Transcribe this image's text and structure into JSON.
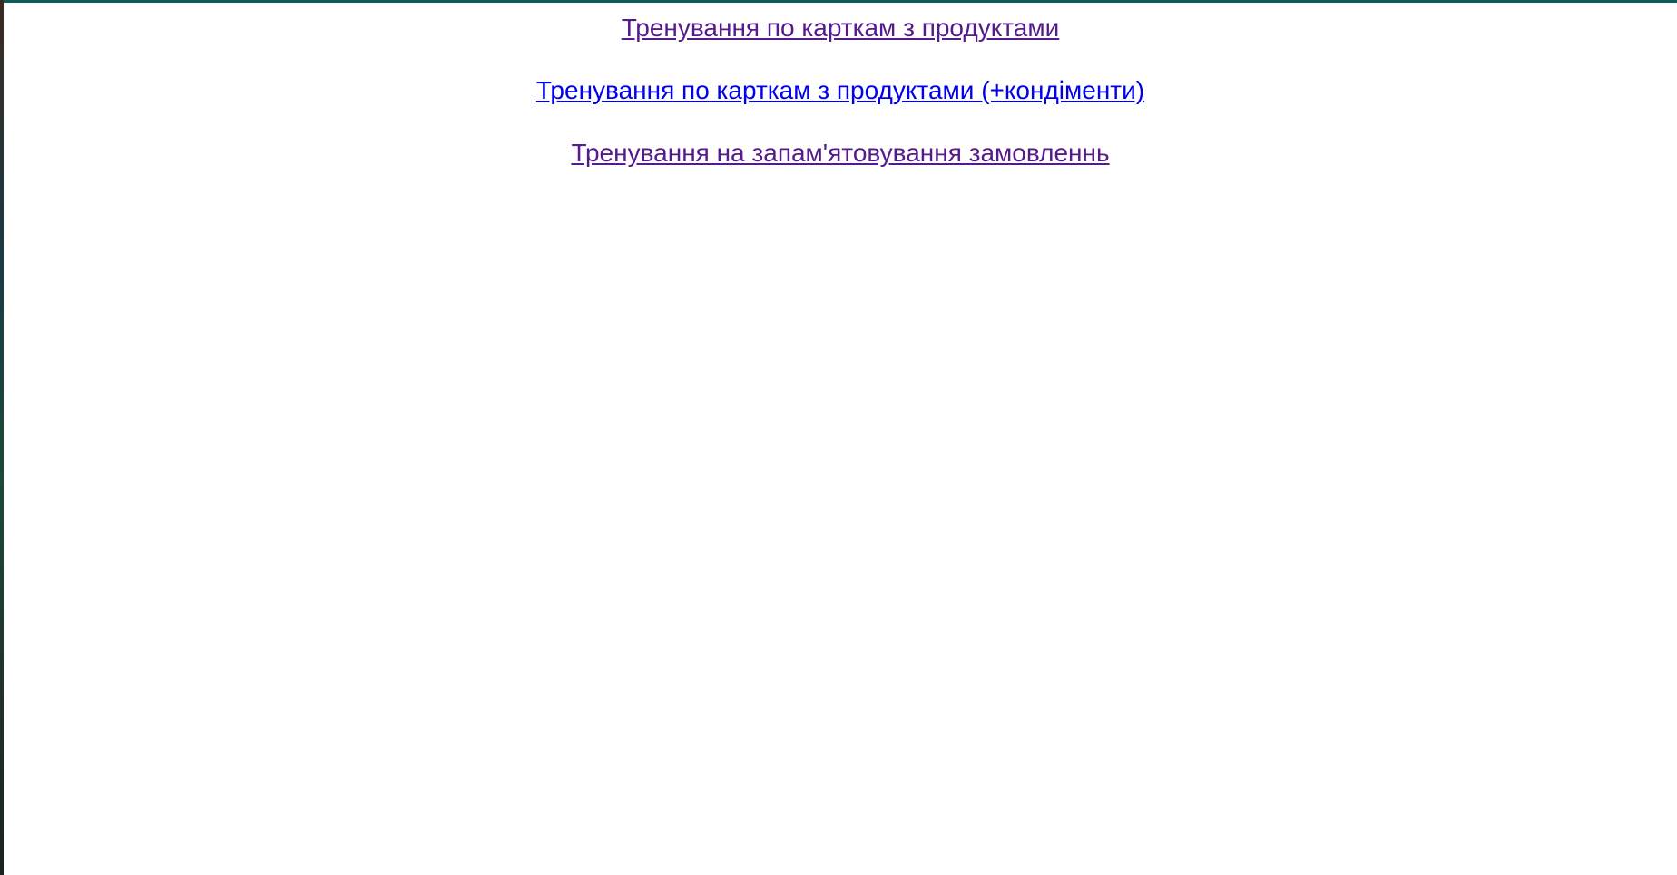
{
  "links": [
    {
      "label": "Тренування по карткам з продуктами",
      "state": "visited",
      "color": "#551a8b"
    },
    {
      "label": "Тренування по карткам з продуктами (+кондіменти)",
      "state": "unvisited",
      "color": "#0000ee"
    },
    {
      "label": "Тренування на запам'ятовування замовленнь",
      "state": "visited",
      "color": "#551a8b"
    }
  ],
  "colors": {
    "background": "#ffffff",
    "top_accent": "#0e5c5a"
  }
}
